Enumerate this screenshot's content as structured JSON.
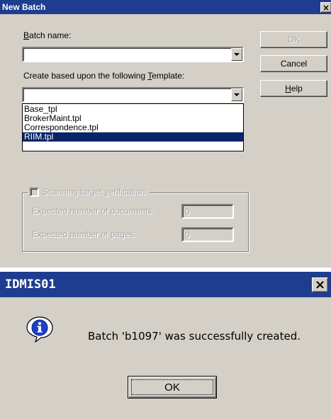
{
  "new_batch": {
    "title": "New Batch",
    "close_label": "×",
    "batch_name_label_pre": "",
    "batch_name_label_key": "B",
    "batch_name_label_post": "atch name:",
    "batch_name_value": "",
    "template_label_pre": "Create based upon the following ",
    "template_label_key": "T",
    "template_label_post": "emplate:",
    "template_value": "",
    "template_options": [
      "Base_tpl",
      "BrokerMaint.tpl",
      "Correspondence.tpl",
      "RIIM.tpl"
    ],
    "selected_index": 3,
    "ok_label": "OK",
    "cancel_label": "Cancel",
    "help_label_key": "H",
    "help_label_post": "elp",
    "scanning_label_pre": "Scanning target ",
    "scanning_label_key": "v",
    "scanning_label_post": "erification:",
    "expected_docs_label": "Expected number of documents:",
    "expected_docs_value": "0",
    "expected_pages_label": "Expected number of pages:",
    "expected_pages_value": "0"
  },
  "message": {
    "title": "IDMIS01",
    "close_label": "×",
    "text": "Batch 'b1097' was successfully created.",
    "ok_label": "OK",
    "icon": "info-icon"
  }
}
